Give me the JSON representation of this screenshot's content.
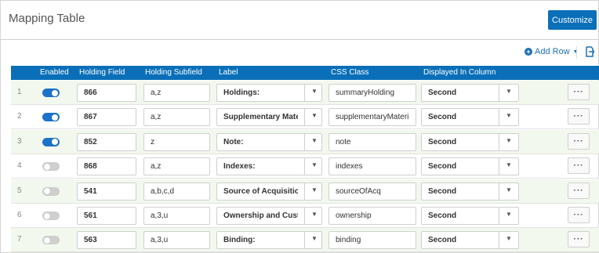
{
  "header": {
    "title": "Mapping Table",
    "customize_label": "Customize"
  },
  "toolbar": {
    "add_row_label": "Add Row",
    "add_row_icon": "plus-circle-icon",
    "export_icon": "export-icon"
  },
  "columns": [
    "Enabled",
    "Holding Field",
    "Holding Subfield",
    "Label",
    "CSS Class",
    "Displayed In Column"
  ],
  "colors": {
    "header_bg": "#0a6fb8",
    "toggle_on": "#1a73c7",
    "row_alt": "#f3f8ee"
  },
  "rows": [
    {
      "num": "1",
      "enabled": true,
      "field": "866",
      "subfield": "a,z",
      "label": "Holdings:",
      "css_class": "summaryHolding",
      "column": "Second"
    },
    {
      "num": "2",
      "enabled": true,
      "field": "867",
      "subfield": "a,z",
      "label": "Supplementary Mater",
      "css_class": "supplementaryMateri",
      "column": "Second"
    },
    {
      "num": "3",
      "enabled": true,
      "field": "852",
      "subfield": "z",
      "label": "Note:",
      "css_class": "note",
      "column": "Second"
    },
    {
      "num": "4",
      "enabled": false,
      "field": "868",
      "subfield": "a,z",
      "label": "Indexes:",
      "css_class": "indexes",
      "column": "Second"
    },
    {
      "num": "5",
      "enabled": false,
      "field": "541",
      "subfield": "a,b,c,d",
      "label": "Source of Acquisition",
      "css_class": "sourceOfAcq",
      "column": "Second"
    },
    {
      "num": "6",
      "enabled": false,
      "field": "561",
      "subfield": "a,3,u",
      "label": "Ownership and Custo",
      "css_class": "ownership",
      "column": "Second"
    },
    {
      "num": "7",
      "enabled": false,
      "field": "563",
      "subfield": "a,3,u",
      "label": "Binding:",
      "css_class": "binding",
      "column": "Second"
    }
  ],
  "row_actions_label": "···"
}
